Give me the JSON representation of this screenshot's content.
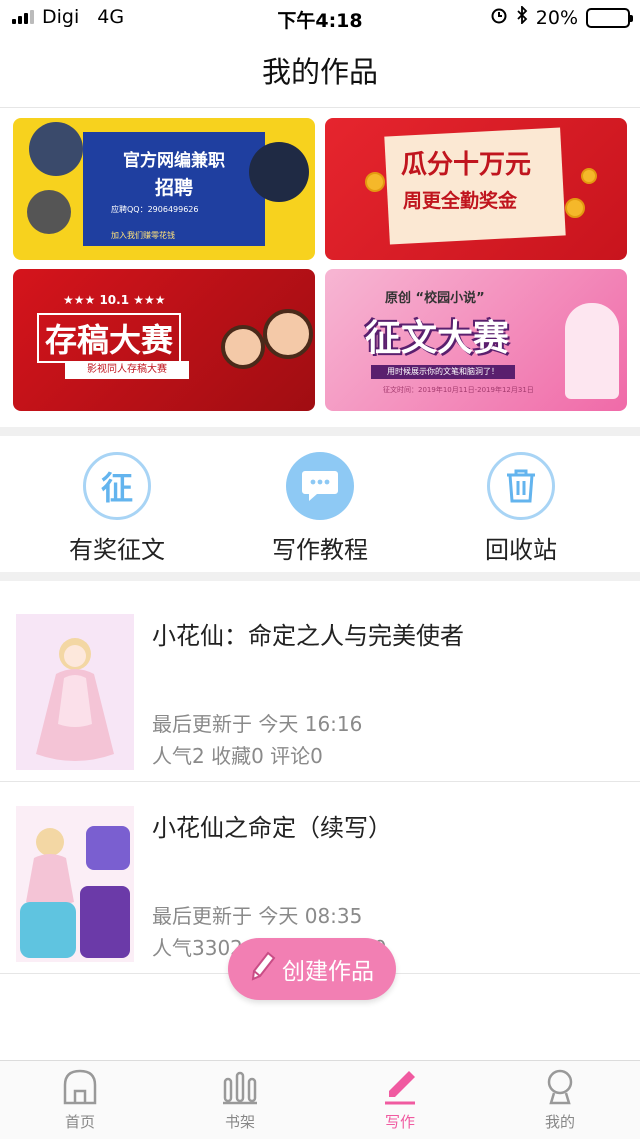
{
  "status_bar": {
    "carrier": "Digi",
    "network": "4G",
    "time": "下午4:18",
    "battery": "20%",
    "battery_level": 0.2
  },
  "navbar": {
    "title": "我的作品"
  },
  "banners": {
    "b1": {
      "title": "官方网编兼职",
      "subtitle": "招聘",
      "qq": "应聘QQ：2906499626",
      "tags": "加入我们赚零花钱"
    },
    "b2": {
      "title": "瓜分十万元",
      "subtitle": "周更全勤奖金"
    },
    "b3": {
      "date": "★★★ 10.1 ★★★",
      "title": "存稿大赛",
      "subtitle": "影视同人存稿大赛"
    },
    "b4": {
      "tag": "原创 “校园小说”",
      "title": "征文大赛",
      "bar": "用时候展示你的文笔和脑洞了！",
      "date": "征文时间：2019年10月11日-2019年12月31日"
    }
  },
  "actions": [
    {
      "label": "有奖征文",
      "icon": "征"
    },
    {
      "label": "写作教程"
    },
    {
      "label": "回收站"
    }
  ],
  "works": [
    {
      "title": "小花仙：命定之人与完美使者",
      "updated": "最后更新于 今天 16:16",
      "stats": "人气2 收藏0 评论0"
    },
    {
      "title": "小花仙之命定（续写）",
      "updated": "最后更新于 今天 08:35",
      "stats": "人气3302 收藏57 评论10"
    }
  ],
  "create_button": {
    "label": "创建作品"
  },
  "tabs": [
    {
      "label": "首页"
    },
    {
      "label": "书架"
    },
    {
      "label": "写作"
    },
    {
      "label": "我的"
    }
  ],
  "colors": {
    "accent_pink": "#f05aa0",
    "accent_blue": "#63b4ee",
    "muted_text": "#8a8a8a"
  }
}
